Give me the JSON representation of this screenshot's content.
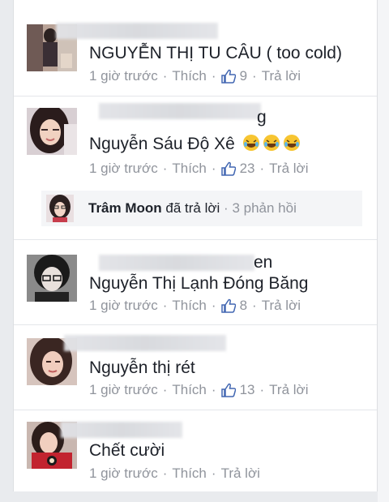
{
  "comments": [
    {
      "name_visible": "",
      "text": "NGUYỄN THỊ TU CÂU ( too cold)",
      "time": "1 giờ trước",
      "like_label": "Thích",
      "like_count": "9",
      "reply_label": "Trả lời"
    },
    {
      "name_visible": "g",
      "text": "Nguyễn Sáu Độ Xê",
      "time": "1 giờ trước",
      "like_label": "Thích",
      "like_count": "23",
      "reply_label": "Trả lời",
      "emoji": [
        "😂",
        "😂",
        "😂"
      ]
    },
    {
      "name_visible": "en",
      "text": "Nguyễn Thị Lạnh Đóng Băng",
      "time": "1 giờ trước",
      "like_label": "Thích",
      "like_count": "8",
      "reply_label": "Trả lời"
    },
    {
      "name_visible": "",
      "text": "Nguyễn thị rét",
      "time": "1 giờ trước",
      "like_label": "Thích",
      "like_count": "13",
      "reply_label": "Trả lời"
    },
    {
      "name_visible": "",
      "text": "Chết cười",
      "time": "1 giờ trước",
      "like_label": "Thích",
      "reply_label": "Trả lời"
    }
  ],
  "reply_summary": {
    "author": "Trâm Moon",
    "action": "đã trả lời",
    "count": "3 phản hồi"
  },
  "colors": {
    "text": "#1d2129",
    "meta": "#90949c",
    "like_icon": "#4267b2"
  }
}
